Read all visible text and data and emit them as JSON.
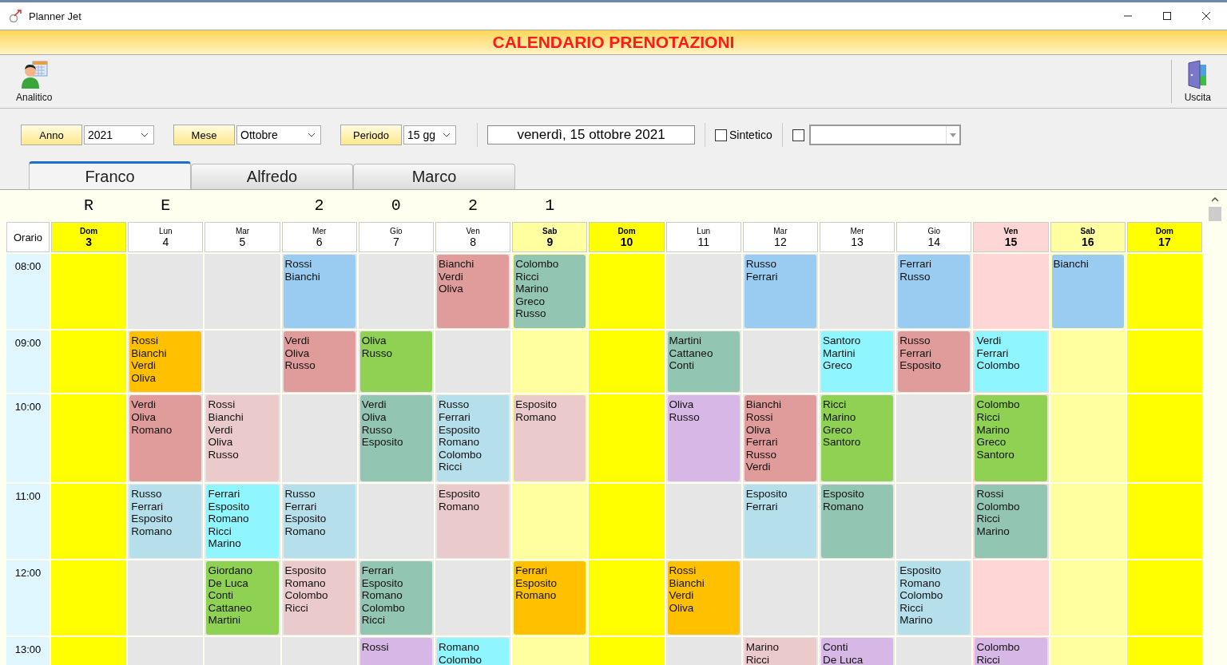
{
  "window": {
    "title": "Planner Jet"
  },
  "banner": "CALENDARIO PRENOTAZIONI",
  "toolbar": [
    {
      "label": "Analitico",
      "kind": "person"
    },
    {
      "label": "Uscita",
      "kind": "exit"
    }
  ],
  "filters": {
    "year": {
      "label": "Anno",
      "value": "2021"
    },
    "month": {
      "label": "Mese",
      "value": "Ottobre"
    },
    "period": {
      "label": "Periodo",
      "value": "15 gg"
    },
    "date": "venerdì, 15 ottobre 2021",
    "sintetico": {
      "label": "Sintetico",
      "checked": false
    },
    "extra": {
      "checked": false
    }
  },
  "tabs": [
    {
      "label": "Franco",
      "selected": true
    },
    {
      "label": "Alfredo",
      "selected": false
    },
    {
      "label": "Marco",
      "selected": false
    }
  ],
  "month_banner": "RE 2021",
  "time_header": "Orario",
  "days": [
    {
      "name": "Dom",
      "number": "3",
      "kind": "sunday",
      "selected": false
    },
    {
      "name": "Lun",
      "number": "4",
      "kind": "weekday",
      "selected": false
    },
    {
      "name": "Mar",
      "number": "5",
      "kind": "weekday",
      "selected": false
    },
    {
      "name": "Mer",
      "number": "6",
      "kind": "weekday",
      "selected": false
    },
    {
      "name": "Gio",
      "number": "7",
      "kind": "weekday",
      "selected": false
    },
    {
      "name": "Ven",
      "number": "8",
      "kind": "weekday",
      "selected": false
    },
    {
      "name": "Sab",
      "number": "9",
      "kind": "saturday",
      "selected": false
    },
    {
      "name": "Dom",
      "number": "10",
      "kind": "sunday",
      "selected": false
    },
    {
      "name": "Lun",
      "number": "11",
      "kind": "weekday",
      "selected": false
    },
    {
      "name": "Mar",
      "number": "12",
      "kind": "weekday",
      "selected": false
    },
    {
      "name": "Mer",
      "number": "13",
      "kind": "weekday",
      "selected": false
    },
    {
      "name": "Gio",
      "number": "14",
      "kind": "weekday",
      "selected": false
    },
    {
      "name": "Ven",
      "number": "15",
      "kind": "weekday",
      "selected": true
    },
    {
      "name": "Sab",
      "number": "16",
      "kind": "saturday",
      "selected": false
    },
    {
      "name": "Dom",
      "number": "17",
      "kind": "sunday",
      "selected": false
    }
  ],
  "rows": [
    {
      "time": "08:00",
      "cells": [
        {},
        {},
        {},
        {
          "names": [
            "Rossi",
            "Bianchi"
          ],
          "color": "#99ccf0"
        },
        {},
        {
          "names": [
            "Bianchi",
            "Verdi",
            "Oliva"
          ],
          "color": "#e09b9b"
        },
        {
          "names": [
            "Colombo",
            "Ricci",
            "Marino",
            "Greco",
            "Russo"
          ],
          "color": "#93c6b2"
        },
        {},
        {},
        {
          "names": [
            "Russo",
            "Ferrari"
          ],
          "color": "#99ccf0"
        },
        {},
        {
          "names": [
            "Ferrari",
            "Russo"
          ],
          "color": "#99ccf0"
        },
        {},
        {
          "names": [
            "Bianchi"
          ],
          "color": "#99ccf0"
        },
        {}
      ]
    },
    {
      "time": "09:00",
      "cells": [
        {},
        {
          "names": [
            "Rossi",
            "Bianchi",
            "Verdi",
            "Oliva"
          ],
          "color": "#ffc000"
        },
        {},
        {
          "names": [
            "Verdi",
            "Oliva",
            "Russo"
          ],
          "color": "#e09b9b"
        },
        {
          "names": [
            "Oliva",
            "Russo"
          ],
          "color": "#8fd152"
        },
        {},
        {},
        {},
        {
          "names": [
            "Martini",
            "Cattaneo",
            "Conti"
          ],
          "color": "#93c6b2"
        },
        {},
        {
          "names": [
            "Santoro",
            "Martini",
            "Greco"
          ],
          "color": "#8ff6ff"
        },
        {
          "names": [
            "Russo",
            "Ferrari",
            "Esposito"
          ],
          "color": "#e09b9b"
        },
        {
          "names": [
            "Verdi",
            "Ferrari",
            "Colombo"
          ],
          "color": "#8ff6ff"
        },
        {},
        {}
      ]
    },
    {
      "time": "10:00",
      "cells": [
        {},
        {
          "names": [
            "Verdi",
            "Oliva",
            "Romano"
          ],
          "color": "#e09b9b"
        },
        {
          "names": [
            "Rossi",
            "Bianchi",
            "Verdi",
            "Oliva",
            "Russo"
          ],
          "color": "#ebcacb"
        },
        {},
        {
          "names": [
            "Verdi",
            "Oliva",
            "Russo",
            "Esposito"
          ],
          "color": "#93c6b2"
        },
        {
          "names": [
            "Russo",
            "Ferrari",
            "Esposito",
            "Romano",
            "Colombo",
            "Ricci"
          ],
          "color": "#b5dfea"
        },
        {
          "names": [
            "Esposito",
            "Romano"
          ],
          "color": "#ebcacb"
        },
        {},
        {
          "names": [
            "Oliva",
            "Russo"
          ],
          "color": "#d7b7e5"
        },
        {
          "names": [
            "Bianchi",
            "Rossi",
            "Oliva",
            "Ferrari",
            "Russo",
            "Verdi"
          ],
          "color": "#e09b9b"
        },
        {
          "names": [
            "Ricci",
            "Marino",
            "Greco",
            "Santoro"
          ],
          "color": "#8fd152"
        },
        {},
        {
          "names": [
            "Colombo",
            "Ricci",
            "Marino",
            "Greco",
            "Santoro"
          ],
          "color": "#8fd152"
        },
        {},
        {}
      ]
    },
    {
      "time": "11:00",
      "cells": [
        {},
        {
          "names": [
            "Russo",
            "Ferrari",
            "Esposito",
            "Romano"
          ],
          "color": "#b5dfea"
        },
        {
          "names": [
            "Ferrari",
            "Esposito",
            "Romano",
            "Ricci",
            "Marino"
          ],
          "color": "#8ff6ff"
        },
        {
          "names": [
            "Russo",
            "Ferrari",
            "Esposito",
            "Romano"
          ],
          "color": "#b5dfea"
        },
        {},
        {
          "names": [
            "Esposito",
            "Romano"
          ],
          "color": "#ebcacb"
        },
        {},
        {},
        {},
        {
          "names": [
            "Esposito",
            "Ferrari"
          ],
          "color": "#b5dfea"
        },
        {
          "names": [
            "Esposito",
            "Romano"
          ],
          "color": "#93c6b2"
        },
        {},
        {
          "names": [
            "Rossi",
            "Colombo",
            "Ricci",
            "Marino"
          ],
          "color": "#93c6b2"
        },
        {},
        {}
      ]
    },
    {
      "time": "12:00",
      "cells": [
        {},
        {},
        {
          "names": [
            "Giordano",
            "De Luca",
            "Conti",
            "Cattaneo",
            "Martini"
          ],
          "color": "#8fd152"
        },
        {
          "names": [
            "Esposito",
            "Romano",
            "Colombo",
            "Ricci"
          ],
          "color": "#ebcacb"
        },
        {
          "names": [
            "Ferrari",
            "Esposito",
            "Romano",
            "Colombo",
            "Ricci"
          ],
          "color": "#93c6b2"
        },
        {},
        {
          "names": [
            "Ferrari",
            "Esposito",
            "Romano"
          ],
          "color": "#ffc000"
        },
        {},
        {
          "names": [
            "Rossi",
            "Bianchi",
            "Verdi",
            "Oliva"
          ],
          "color": "#ffc000"
        },
        {},
        {},
        {
          "names": [
            "Esposito",
            "Romano",
            "Colombo",
            "Ricci",
            "Marino"
          ],
          "color": "#b5dfea"
        },
        {},
        {},
        {}
      ]
    },
    {
      "time": "13:00",
      "cells": [
        {},
        {},
        {},
        {},
        {
          "names": [
            "Rossi"
          ],
          "color": "#d7b7e5"
        },
        {
          "names": [
            "Romano",
            "Colombo"
          ],
          "color": "#8ff6ff"
        },
        {},
        {},
        {},
        {
          "names": [
            "Marino",
            "Ricci"
          ],
          "color": "#ebcacb"
        },
        {
          "names": [
            "Conti",
            "De Luca"
          ],
          "color": "#d7b7e5"
        },
        {},
        {
          "names": [
            "Colombo",
            "Ricci"
          ],
          "color": "#d7b7e5"
        },
        {},
        {}
      ]
    }
  ]
}
